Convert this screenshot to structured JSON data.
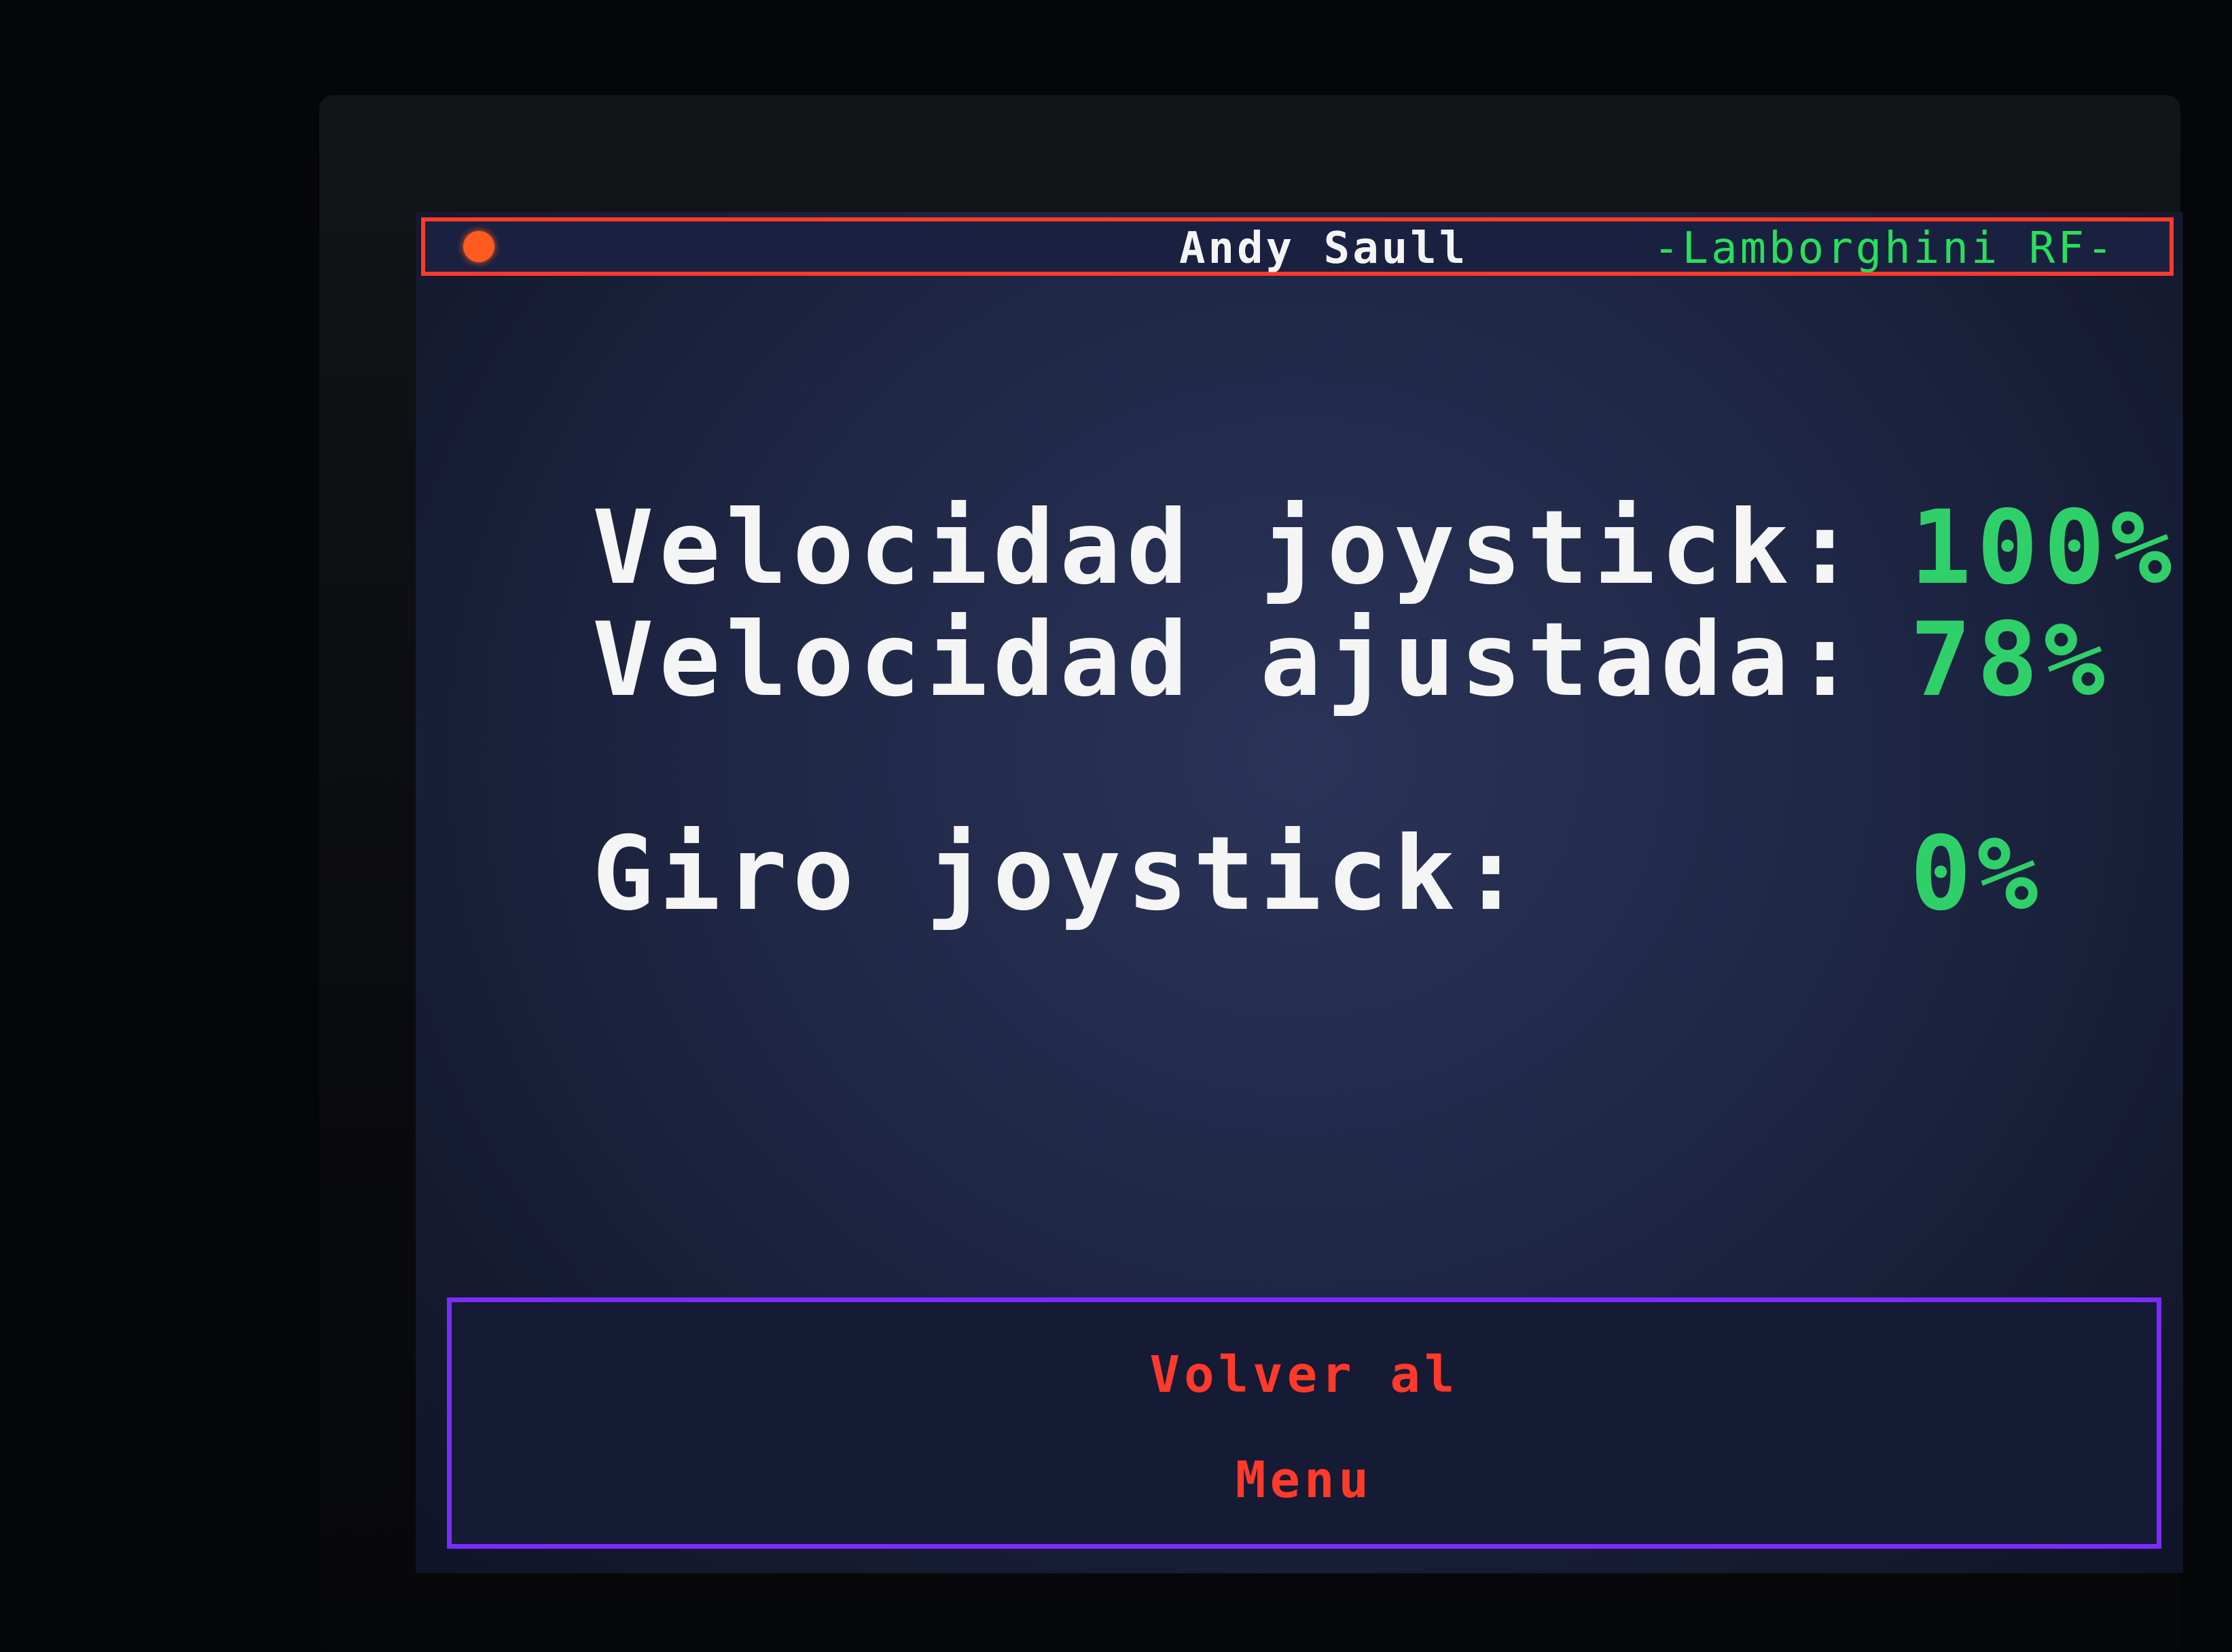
{
  "header": {
    "user_name": "Andy Saull",
    "model_name": "-Lamborghini RF-",
    "status_indicator_color": "#ff5a1f"
  },
  "readings": {
    "joystick_speed_label": "Velocidad joystick:",
    "joystick_speed_value": "100%",
    "adjusted_speed_label": "Velocidad ajustada:",
    "adjusted_speed_value": "78%",
    "joystick_turn_label": "Giro joystick:",
    "joystick_turn_value": "0%"
  },
  "footer": {
    "back_button_line1": "Volver al",
    "back_button_line2": "Menu"
  },
  "colors": {
    "header_border": "#ff3a2a",
    "label_text": "#f5f5f5",
    "value_text": "#2fd06a",
    "footer_border": "#7a2cff",
    "footer_text": "#ff3a2a"
  }
}
